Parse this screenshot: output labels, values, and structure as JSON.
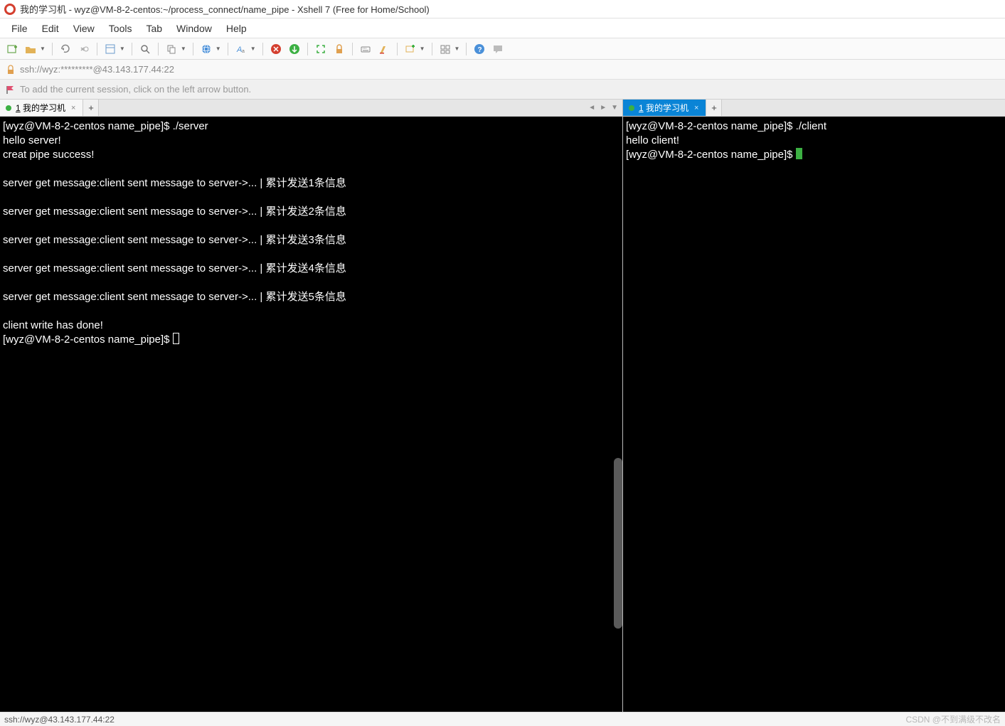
{
  "window": {
    "title": "我的学习机 - wyz@VM-8-2-centos:~/process_connect/name_pipe - Xshell 7 (Free for Home/School)"
  },
  "menu": {
    "file": "File",
    "edit": "Edit",
    "view": "View",
    "tools": "Tools",
    "tab": "Tab",
    "window": "Window",
    "help": "Help"
  },
  "toolbar_icons": {
    "new_tab": "new-tab",
    "open_session": "open-session",
    "reconnect": "reconnect",
    "disconnect": "disconnect",
    "clipboard": "clipboard",
    "search": "search",
    "copy": "copy",
    "globe": "globe",
    "font": "font",
    "xshell": "xshell",
    "xftp": "xftp",
    "fullscreen": "fullscreen",
    "lock": "lock",
    "keyboard": "keyboard",
    "highlight": "highlight",
    "tile": "tile",
    "layout": "layout",
    "help": "help",
    "feedback": "feedback"
  },
  "address_bar": {
    "url": "ssh://wyz:*********@43.143.177.44:22"
  },
  "hint_bar": {
    "text": "To add the current session, click on the left arrow button."
  },
  "panes": {
    "left": {
      "tab_index": "1",
      "tab_label": "我的学习机",
      "terminal": "[wyz@VM-8-2-centos name_pipe]$ ./server\nhello server!\ncreat pipe success!\n\nserver get message:client sent message to server->... | 累计发送1条信息\n\nserver get message:client sent message to server->... | 累计发送2条信息\n\nserver get message:client sent message to server->... | 累计发送3条信息\n\nserver get message:client sent message to server->... | 累计发送4条信息\n\nserver get message:client sent message to server->... | 累计发送5条信息\n\nclient write has done!\n[wyz@VM-8-2-centos name_pipe]$ "
    },
    "right": {
      "tab_index": "1",
      "tab_label": "我的学习机",
      "terminal": "[wyz@VM-8-2-centos name_pipe]$ ./client\nhello client!\n[wyz@VM-8-2-centos name_pipe]$ "
    }
  },
  "statusbar": {
    "left": "ssh://wyz@43.143.177.44:22",
    "watermark": "CSDN @不到满级不改名"
  }
}
